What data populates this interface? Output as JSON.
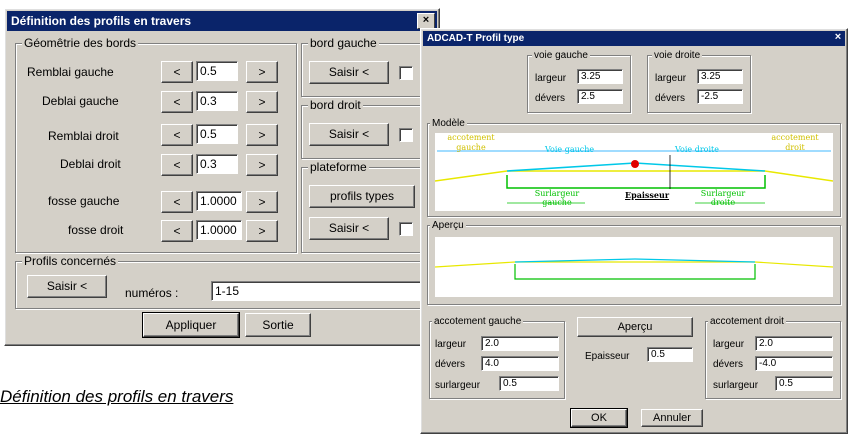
{
  "dialog1": {
    "title": "Définition des profils en travers",
    "close": "×",
    "geometry": {
      "legend": "Géomêtrie des bords",
      "rows": [
        {
          "label": "Remblai gauche",
          "value": "0.5"
        },
        {
          "label": "Deblai gauche",
          "value": "0.3"
        },
        {
          "label": "Remblai droit",
          "value": "0.5"
        },
        {
          "label": "Deblai droit",
          "value": "0.3"
        },
        {
          "label": "fosse gauche",
          "value": "1.0000"
        },
        {
          "label": "fosse droit",
          "value": "1.0000"
        }
      ],
      "dec": "<",
      "inc": ">"
    },
    "bord_gauche": {
      "legend": "bord gauche",
      "button": "Saisir <"
    },
    "bord_droit": {
      "legend": "bord droit",
      "button": "Saisir <"
    },
    "plateforme": {
      "legend": "plateforme",
      "profils_button": "profils types",
      "button": "Saisir <"
    },
    "profils": {
      "legend": "Profils concernés",
      "button": "Saisir <",
      "label": "numéros :",
      "value": "1-15"
    },
    "apply": "Appliquer",
    "exit": "Sortie"
  },
  "caption": "Définition des profils en travers",
  "dialog2": {
    "title": "ADCAD-T Profil type",
    "close": "×",
    "voie_gauche": {
      "legend": "voie gauche",
      "largeur_label": "largeur",
      "largeur": "3.25",
      "devers_label": "dévers",
      "devers": "2.5"
    },
    "voie_droite": {
      "legend": "voie droite",
      "largeur_label": "largeur",
      "largeur": "3.25",
      "devers_label": "dévers",
      "devers": "-2.5"
    },
    "modele": {
      "legend": "Modèle",
      "acc_gauche": "accotement gauche",
      "voie_gauche": "Voie gauche",
      "voie_droite": "Voie droite",
      "acc_droit": "accotement droit",
      "surlargeur_gauche": "Surlargeur gauche",
      "epaisseur": "Epaisseur",
      "surlargeur_droite": "Surlargeur droite"
    },
    "apercu": {
      "legend": "Aperçu"
    },
    "acc_gauche": {
      "legend": "accotement gauche",
      "largeur_label": "largeur",
      "largeur": "2.0",
      "devers_label": "dévers",
      "devers": "4.0",
      "surlargeur_label": "surlargeur",
      "surlargeur": "0.5"
    },
    "apercu_button": "Aperçu",
    "epaisseur_label": "Epaisseur",
    "epaisseur": "0.5",
    "acc_droit": {
      "legend": "accotement droit",
      "largeur_label": "largeur",
      "largeur": "2.0",
      "devers_label": "dévers",
      "devers": "-4.0",
      "surlargeur_label": "surlargeur",
      "surlargeur": "0.5"
    },
    "ok": "OK",
    "cancel": "Annuler"
  },
  "colors": {
    "titlebar": "#0a246a",
    "face": "#d4d0c8",
    "yellow": "#e8e800",
    "cyan": "#00c8e8",
    "green": "#00c000",
    "red": "#e00000"
  }
}
